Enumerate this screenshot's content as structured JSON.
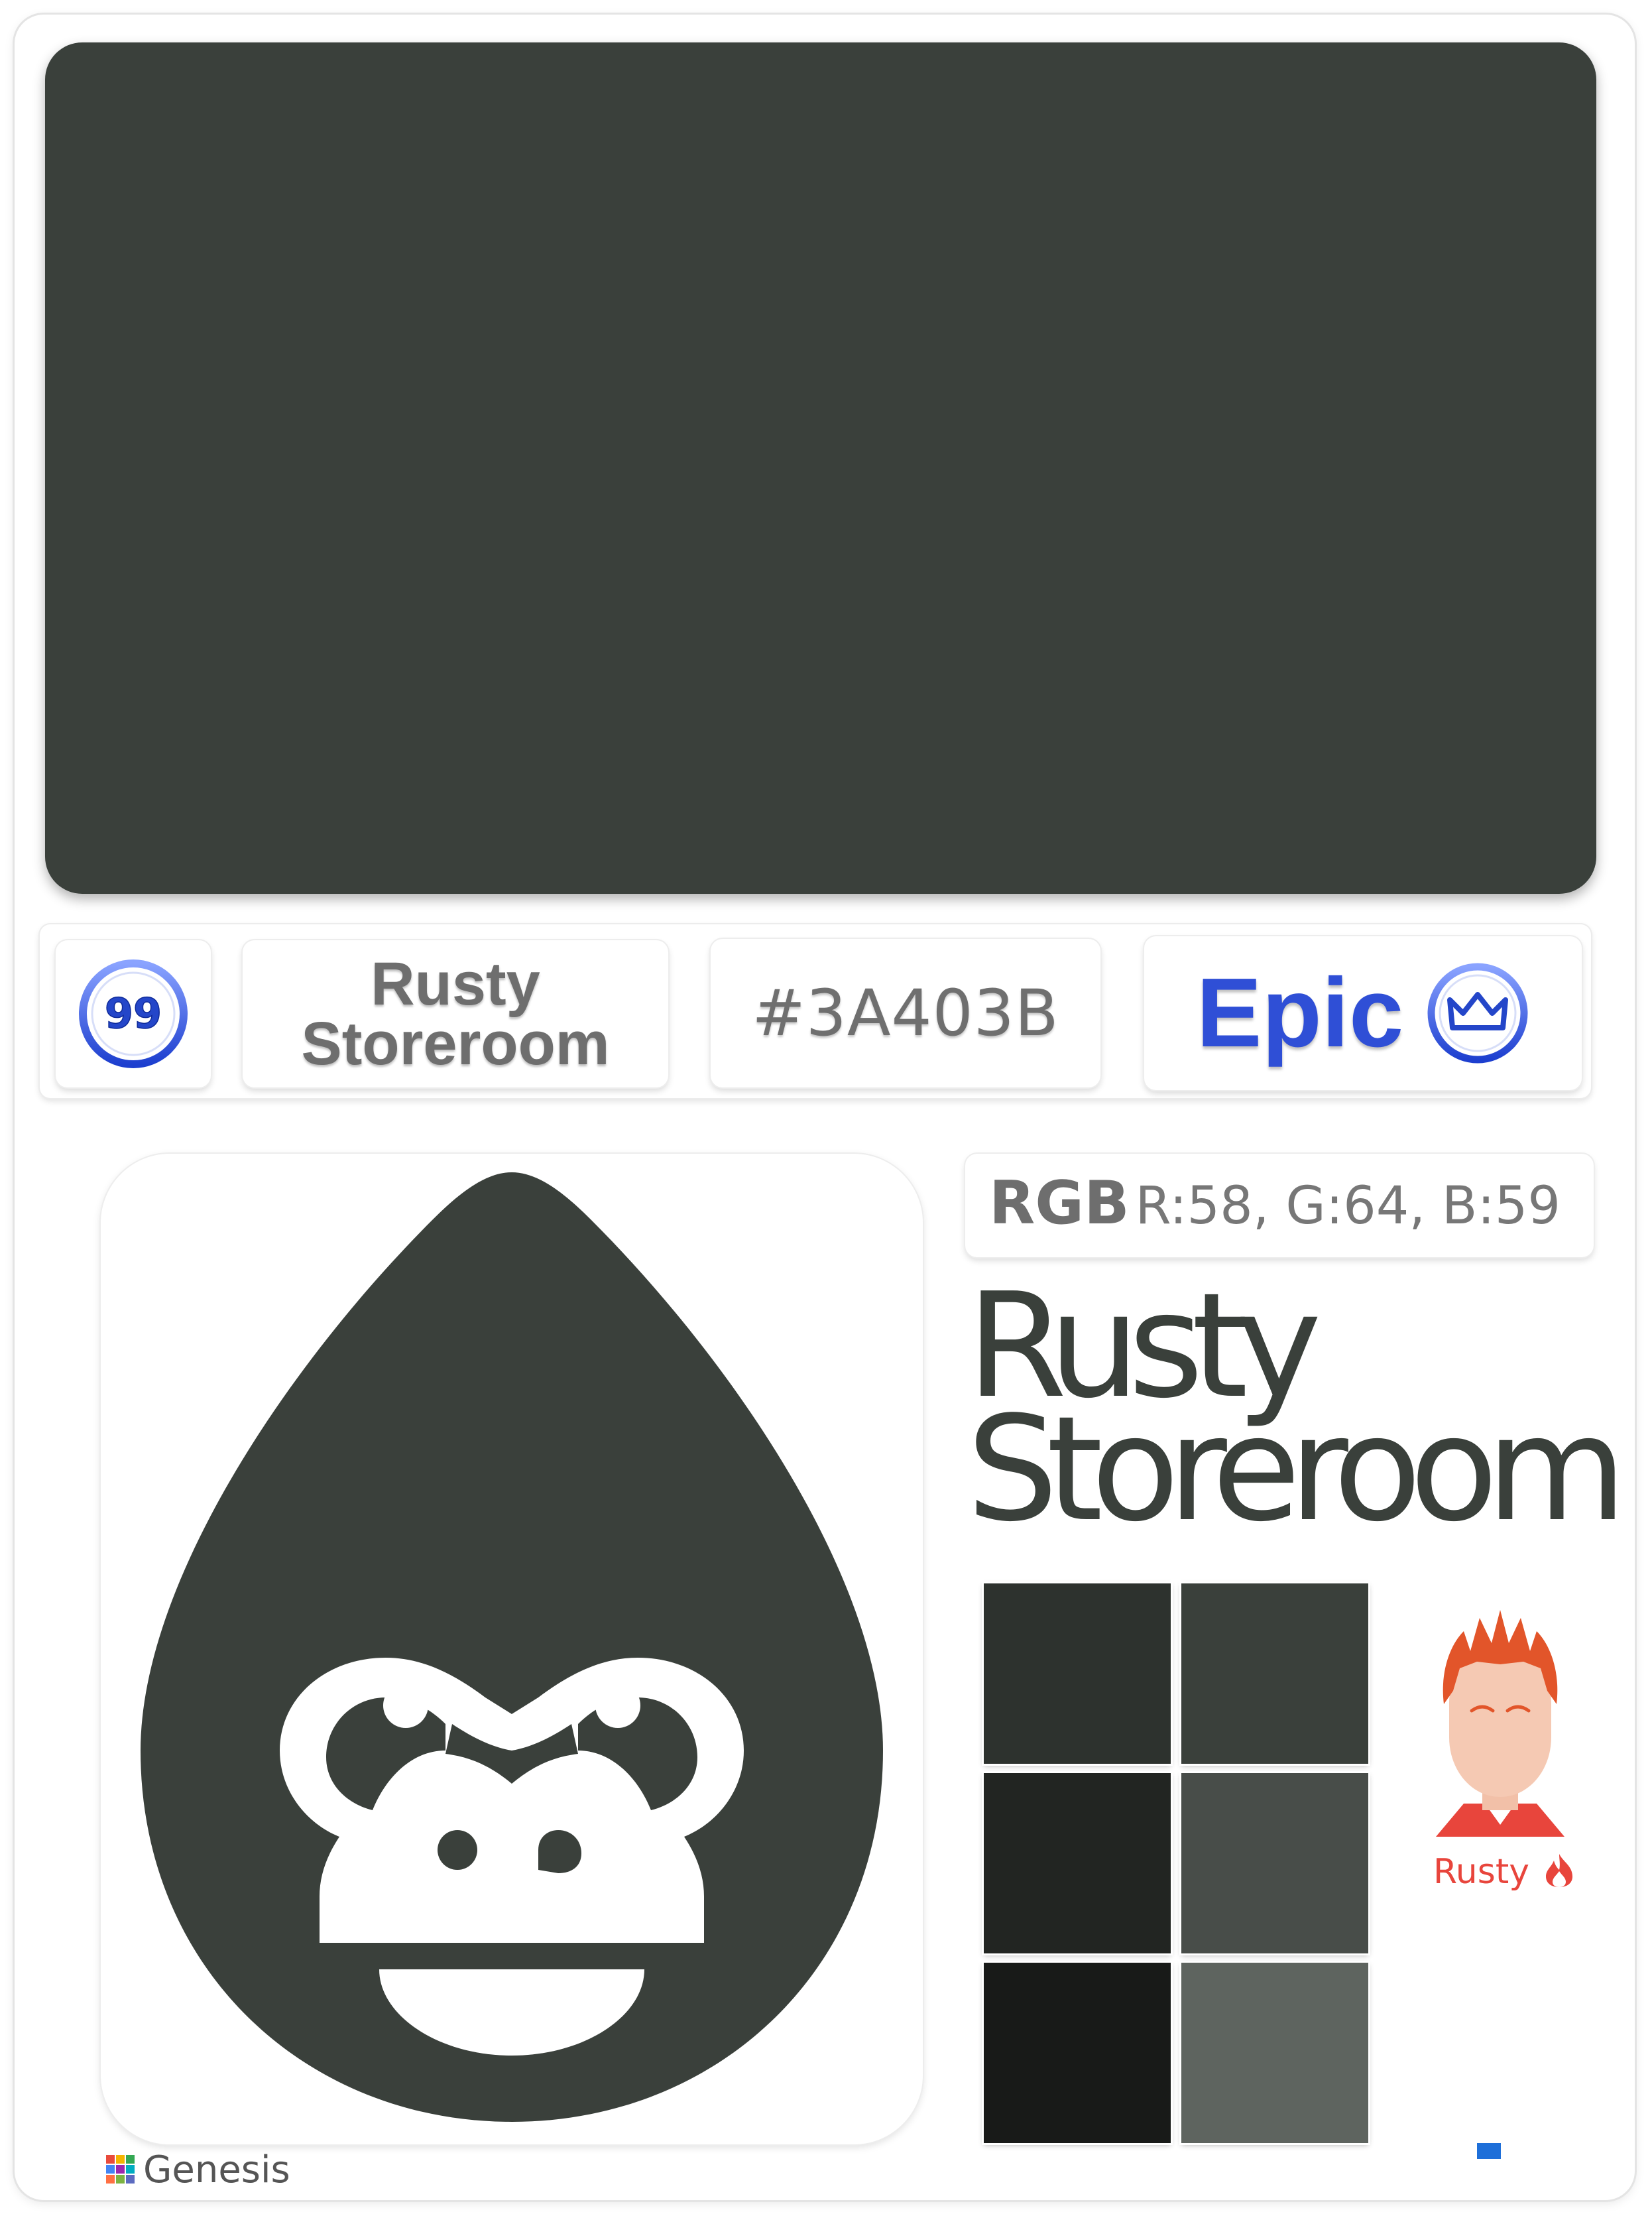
{
  "color": {
    "name": "Rusty Storeroom",
    "name_line1": "Rusty",
    "name_line2": "Storeroom",
    "hex": "#3A403B",
    "hex_value": "#3a403b",
    "rgb_label": "RGB",
    "rgb_value": "R:58, G:64, B:59"
  },
  "badges": {
    "number": "99",
    "rarity": "Epic"
  },
  "icon": {
    "name": "gorilla-drop-icon",
    "fill": "#3a403b"
  },
  "swatches": [
    {
      "color": "#2d322e"
    },
    {
      "color": "#3a403b"
    },
    {
      "color": "#222522"
    },
    {
      "color": "#484d49"
    },
    {
      "color": "#181a18"
    },
    {
      "color": "#5e645f"
    }
  ],
  "avatar": {
    "label": "Rusty",
    "icon": "flame-icon",
    "accent": "#e8453c"
  },
  "brand": {
    "label": "Genesis",
    "icon": "grid-logo-icon"
  },
  "accents": {
    "badge_blue": "#2f4fd6",
    "marker_blue": "#1e6fd9"
  }
}
